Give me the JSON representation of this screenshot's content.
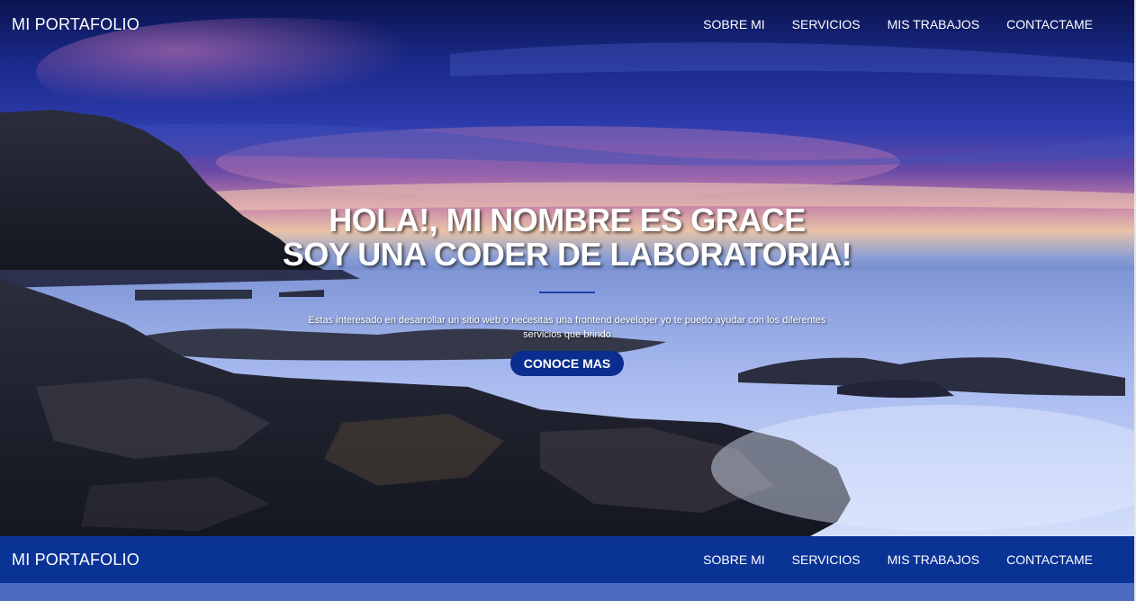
{
  "brand": "MI PORTAFOLIO",
  "nav": {
    "items": [
      {
        "label": "SOBRE MI"
      },
      {
        "label": "SERVICIOS"
      },
      {
        "label": "MIS TRABAJOS"
      },
      {
        "label": "CONTACTAME"
      }
    ]
  },
  "hero": {
    "title_line1": "HOLA!, MI NOMBRE ES GRACE",
    "title_line2": "SOY UNA CODER DE LABORATORIA!",
    "description": "Estas interesado en desarrollar un sitio web o necesitas una frontend developer yo te puedo ayudar con los diferentes servicios que brindo",
    "cta_label": "CONOCE MAS"
  },
  "colors": {
    "nav_bar": "#0a3396",
    "cta": "#0a2d8f",
    "divider": "#1f3fa8",
    "strip": "#4a6bc0"
  }
}
